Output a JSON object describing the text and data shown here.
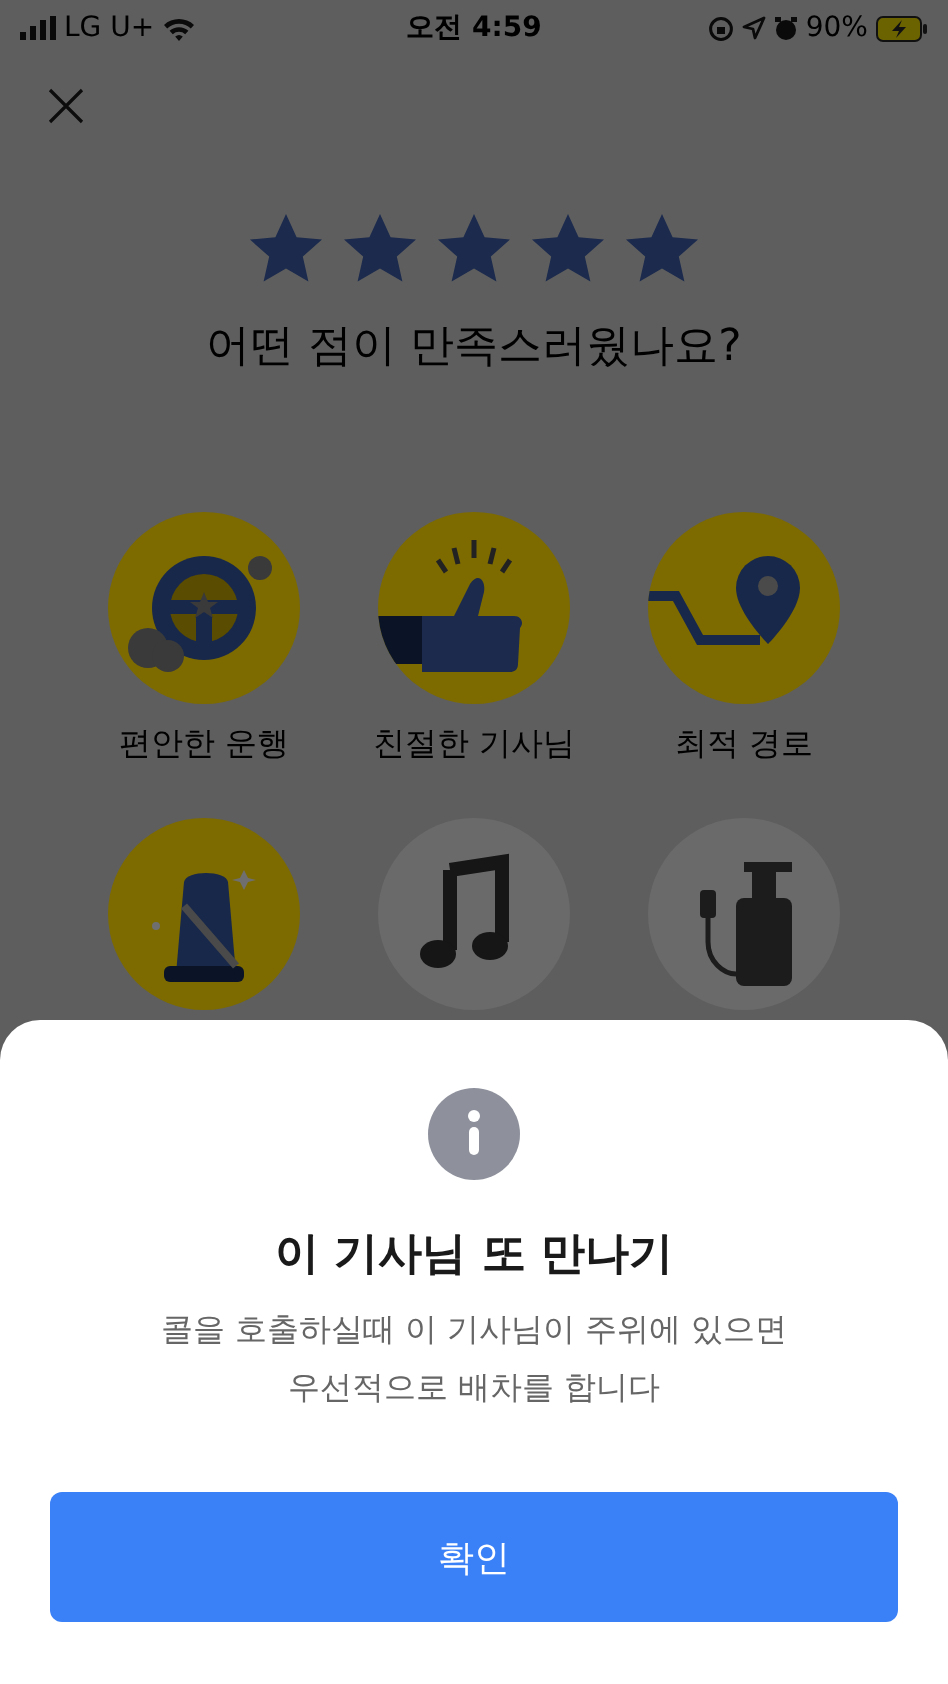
{
  "status_bar": {
    "carrier": "LG U+",
    "time": "오전 4:59",
    "battery": "90%"
  },
  "rating": {
    "stars": 5,
    "question": "어떤 점이 만족스러웠나요?"
  },
  "options": [
    {
      "kind": "steering-wheel",
      "label": "편안한 운행",
      "selected": true
    },
    {
      "kind": "thumbs-up",
      "label": "친절한 기사님",
      "selected": true
    },
    {
      "kind": "map-pin",
      "label": "최적 경로",
      "selected": true
    },
    {
      "kind": "car-seat",
      "selected": true
    },
    {
      "kind": "music",
      "selected": false
    },
    {
      "kind": "sanitizer",
      "selected": false
    }
  ],
  "sheet": {
    "title": "이 기사님 또 만나기",
    "message": "콜을 호출하실때 이 기사님이 주위에 있으면\n우선적으로 배차를 합니다",
    "button": "확인"
  }
}
